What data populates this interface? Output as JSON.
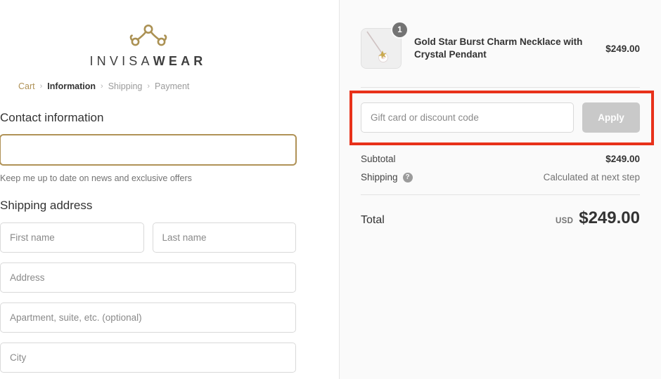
{
  "brand": {
    "logo_icon": "invisawear-ornament-icon",
    "name_light": "INVISA",
    "name_bold": "WEAR",
    "accent_color": "#b09257"
  },
  "breadcrumb": {
    "items": [
      {
        "label": "Cart",
        "state": "link"
      },
      {
        "label": "Information",
        "state": "current"
      },
      {
        "label": "Shipping",
        "state": "upcoming"
      },
      {
        "label": "Payment",
        "state": "upcoming"
      }
    ],
    "separator": "›"
  },
  "contact": {
    "title": "Contact information",
    "email_value": "",
    "email_placeholder": "",
    "newsletter_text": "Keep me up to date on news and exclusive offers"
  },
  "shipping_address": {
    "title": "Shipping address",
    "first_name_placeholder": "First name",
    "last_name_placeholder": "Last name",
    "address_placeholder": "Address",
    "apartment_placeholder": "Apartment, suite, etc. (optional)",
    "city_placeholder": "City"
  },
  "order_summary": {
    "product": {
      "image_icon": "necklace-thumbnail-icon",
      "quantity_badge": "1",
      "title": "Gold Star Burst Charm Necklace with Crystal Pendant",
      "price": "$249.00"
    },
    "discount": {
      "placeholder": "Gift card or discount code",
      "value": "",
      "apply_label": "Apply"
    },
    "lines": [
      {
        "label": "Subtotal",
        "value": "$249.00",
        "help_icon": null,
        "muted": false
      },
      {
        "label": "Shipping",
        "value": "Calculated at next step",
        "help_icon": "?",
        "muted": true
      }
    ],
    "total": {
      "label": "Total",
      "currency": "USD",
      "amount": "$249.00"
    }
  },
  "annotation": {
    "color": "#e8311a",
    "target": "discount-code-row"
  }
}
